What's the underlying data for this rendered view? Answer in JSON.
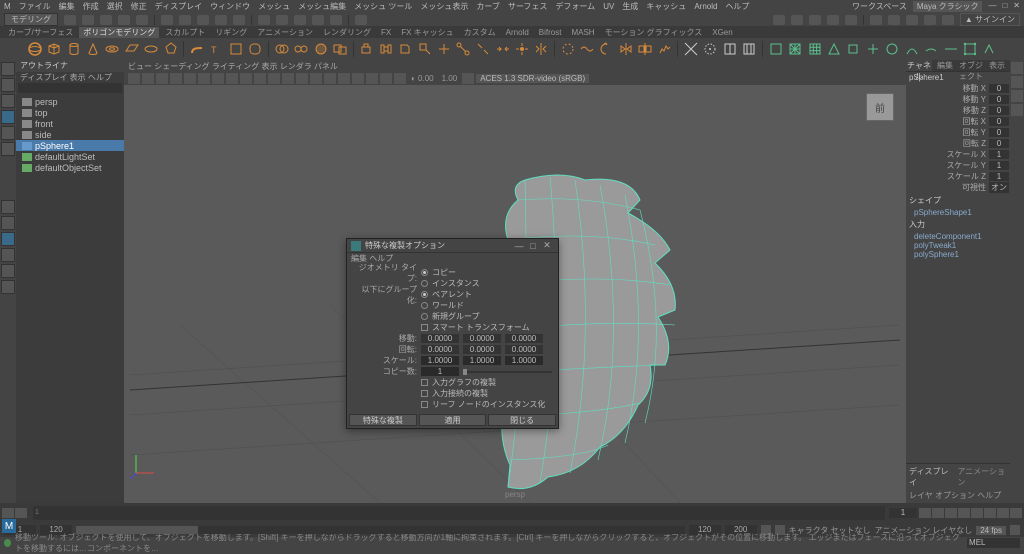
{
  "menubar": [
    "ファイル",
    "編集",
    "作成",
    "選択",
    "修正",
    "ディスプレイ",
    "ウィンドウ",
    "メッシュ",
    "メッシュ編集",
    "メッシュ ツール",
    "メッシュ表示",
    "カーブ",
    "サーフェス",
    "デフォーム",
    "UV",
    "生成",
    "キャッシュ",
    "Arnold",
    "ヘルプ"
  ],
  "menubar_right": {
    "workspace_lbl": "ワークスペース",
    "workspace_val": "Maya クラシック"
  },
  "statusline": {
    "module": "モデリング",
    "signin": "▲ サインイン"
  },
  "shelftabs": [
    "カーブ/サーフェス",
    "ポリゴンモデリング",
    "スカルプト",
    "リギング",
    "アニメーション",
    "レンダリング",
    "FX",
    "FX キャッシュ",
    "カスタム",
    "Arnold",
    "Bifrost",
    "MASH",
    "モーション グラフィックス",
    "XGen"
  ],
  "outliner": {
    "title": "アウトライナ",
    "sub": "ディスプレイ  表示  ヘルプ",
    "search_ph": "",
    "items": [
      {
        "label": "persp",
        "ic": "cam"
      },
      {
        "label": "top",
        "ic": "cam"
      },
      {
        "label": "front",
        "ic": "cam"
      },
      {
        "label": "side",
        "ic": "cam"
      },
      {
        "label": "pSphere1",
        "ic": "mesh",
        "sel": true
      },
      {
        "label": "defaultLightSet",
        "ic": "set"
      },
      {
        "label": "defaultObjectSet",
        "ic": "set"
      }
    ]
  },
  "viewport": {
    "menus": "ビュー  シェーディング  ライティング  表示  レンダラ  パネル",
    "grid": "1.00",
    "colorspace": "ACES 1.3 SDR-video (sRGB)",
    "camlabel": "persp",
    "viewcube": "前"
  },
  "channelbox": {
    "tabs": [
      "チャネル",
      "編集",
      "オブジェクト",
      "表示"
    ],
    "node": "pSphere1",
    "attrs": [
      {
        "l": "移動 X",
        "v": "0"
      },
      {
        "l": "移動 Y",
        "v": "0"
      },
      {
        "l": "移動 Z",
        "v": "0"
      },
      {
        "l": "回転 X",
        "v": "0"
      },
      {
        "l": "回転 Y",
        "v": "0"
      },
      {
        "l": "回転 Z",
        "v": "0"
      },
      {
        "l": "スケール X",
        "v": "1"
      },
      {
        "l": "スケール Y",
        "v": "1"
      },
      {
        "l": "スケール Z",
        "v": "1"
      },
      {
        "l": "可視性",
        "v": "オン"
      }
    ],
    "shape_hdr": "シェイプ",
    "shape": "pSphereShape1",
    "inputs_hdr": "入力",
    "inputs": [
      "deleteComponent1",
      "polyTweak1",
      "polySphere1"
    ],
    "disp_hdr": "ディスプレイ",
    "disp_sub": "レイヤ  オプション  ヘルプ",
    "anim_tab": "アニメーション"
  },
  "dialog": {
    "title": "特殊な複製オプション",
    "menu": "編集  ヘルプ",
    "geotype_lbl": "ジオメトリ タイプ:",
    "geo_copy": "コピー",
    "geo_inst": "インスタンス",
    "group_lbl": "以下にグループ化:",
    "gp_parent": "ペアレント",
    "gp_world": "ワールド",
    "gp_new": "新規グループ",
    "smart": "スマート トランスフォーム",
    "t_lbl": "移動:",
    "r_lbl": "回転:",
    "s_lbl": "スケール:",
    "copies_lbl": "コピー数:",
    "t": [
      "0.0000",
      "0.0000",
      "0.0000"
    ],
    "r": [
      "0.0000",
      "0.0000",
      "0.0000"
    ],
    "s": [
      "1.0000",
      "1.0000",
      "1.0000"
    ],
    "copies": "1",
    "chk1": "入力グラフの複製",
    "chk2": "入力接続の複製",
    "chk3": "リーフ ノードのインスタンス化",
    "btn_apply_close": "特殊な複製",
    "btn_apply": "適用",
    "btn_close": "閉じる"
  },
  "timeline": {
    "start": "1",
    "end": "200",
    "cur": "1",
    "txt1": "キャラクタ セットなし",
    "txt2": "アニメーション レイヤなし",
    "fps": "24 fps"
  },
  "range": {
    "s1": "1",
    "s2": "120",
    "e1": "120",
    "e2": "200"
  },
  "help": "移動ツール: オブジェクトを使用して、オブジェクトを移動します。[Shift] キーを押しながらドラッグすると移動方向が1軸に拘束されます。[Ctrl] キーを押しながらクリックすると、オブジェクトがその位置に移動します。 エッジまたはフェースに沿ってオブジェクトを移動するには…コンポーネントを…",
  "mel": "MEL"
}
